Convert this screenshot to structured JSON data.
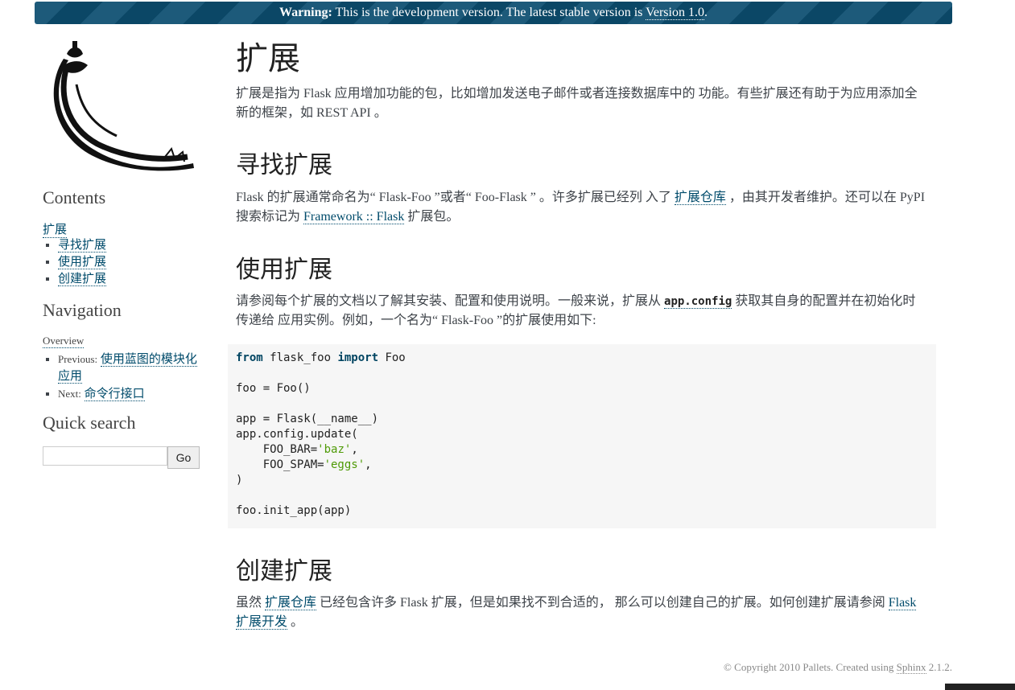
{
  "banner": {
    "warning_label": "Warning:",
    "text": "This is the development version. The latest stable version is",
    "link": "Version 1.0",
    "end": "."
  },
  "sidebar": {
    "contents_heading": "Contents",
    "contents_top": "扩展",
    "contents_items": [
      "寻找扩展",
      "使用扩展",
      "创建扩展"
    ],
    "navigation_heading": "Navigation",
    "overview": "Overview",
    "previous_label": "Previous:",
    "previous_link": "使用蓝图的模块化应用",
    "next_label": "Next:",
    "next_link": "命令行接口",
    "search_heading": "Quick search",
    "search_value": "",
    "go_button": "Go"
  },
  "main": {
    "title": "扩展",
    "intro_p1": "扩展是指为 Flask 应用增加功能的包，比如增加发送电子邮件或者连接数据库中的 功能。有些扩展还有助于为应用添加全新的框架，如 REST API 。",
    "find": {
      "heading": "寻找扩展",
      "t1": "Flask 的扩展通常命名为“ Flask-Foo ”或者“ Foo-Flask ” 。许多扩展已经列 入了 ",
      "link1": "扩展仓库",
      "t2": " ，由其开发者维护。还可以在 PyPI 搜索标记为 ",
      "link2": "Framework :: Flask",
      "t3": " 扩展包。"
    },
    "use": {
      "heading": "使用扩展",
      "t1": "请参阅每个扩展的文档以了解其安装、配置和使用说明。一般来说，扩展从 ",
      "code": "app.config",
      "t2": " 获取其自身的配置并在初始化时传递给 应用实例。例如，一个名为“ Flask-Foo ”的扩展使用如下:"
    },
    "code_block": {
      "kw_from": "from",
      "mod": " flask_foo ",
      "kw_import": "import",
      "cls": " Foo",
      "line2": "foo = Foo()",
      "line3": "app = Flask(__name__)",
      "line4": "app.config.update(",
      "line5a": "    FOO_BAR=",
      "line5s": "'baz'",
      "line6a": "    FOO_SPAM=",
      "line6s": "'eggs'",
      "comma": ",",
      "line7": ")",
      "line8": "foo.init_app(app)"
    },
    "create": {
      "heading": "创建扩展",
      "t1": "虽然 ",
      "link1": "扩展仓库",
      "t2": " 已经包含许多 Flask 扩展，但是如果找不到合适的， 那么可以创建自己的扩展。如何创建扩展请参阅 ",
      "link2": "Flask 扩展开发",
      "t3": " 。"
    }
  },
  "footer": {
    "text": "© Copyright 2010 Pallets. Created using",
    "link": "Sphinx",
    "version": "2.1.2."
  }
}
